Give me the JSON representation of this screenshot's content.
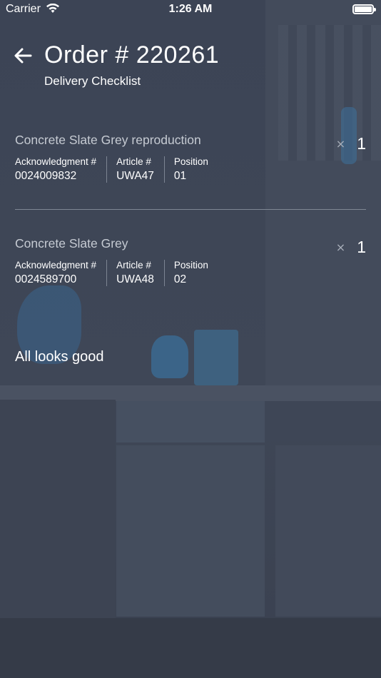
{
  "status_bar": {
    "carrier": "Carrier",
    "time": "1:26 AM",
    "icons": [
      "wifi-icon",
      "battery-icon"
    ]
  },
  "header": {
    "back_icon": "arrow-left-icon",
    "title": "Order # 220261",
    "subtitle": "Delivery Checklist"
  },
  "items": [
    {
      "name": "Concrete Slate Grey reproduction",
      "quantity_symbol": "×",
      "quantity": "1",
      "fields": [
        {
          "label": "Acknowledgment #",
          "value": "0024009832"
        },
        {
          "label": "Article #",
          "value": "UWA47"
        },
        {
          "label": "Position",
          "value": "01"
        }
      ]
    },
    {
      "name": "Concrete Slate Grey",
      "quantity_symbol": "×",
      "quantity": "1",
      "fields": [
        {
          "label": "Acknowledgment #",
          "value": "0024589700"
        },
        {
          "label": "Article #",
          "value": "UWA48"
        },
        {
          "label": "Position",
          "value": "02"
        }
      ]
    }
  ],
  "summary": "All looks good"
}
